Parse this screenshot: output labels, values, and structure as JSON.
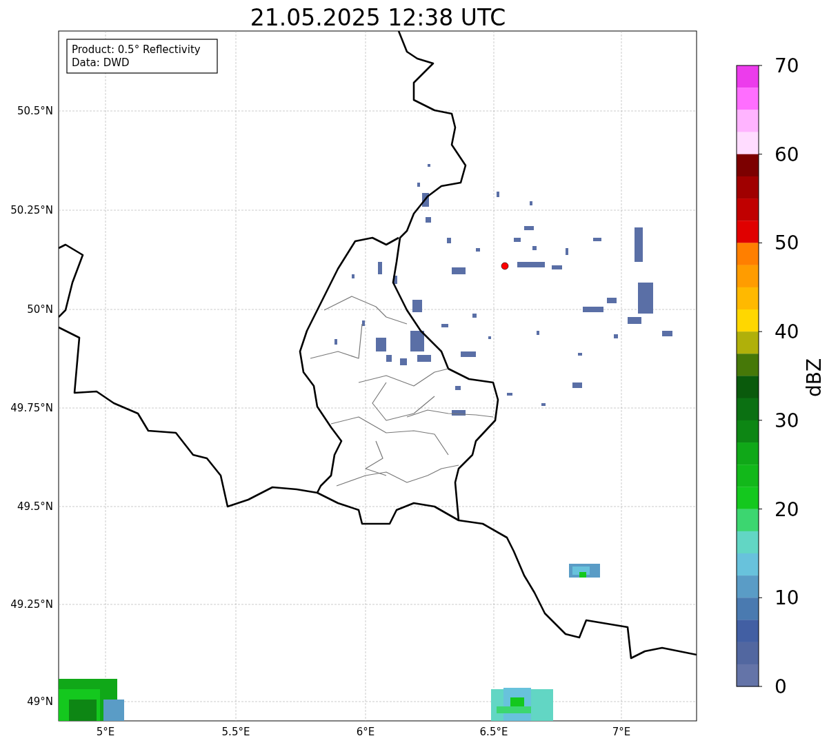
{
  "title": "21.05.2025 12:38 UTC",
  "info_box": [
    "Product: 0.5° Reflectivity",
    "Data: DWD"
  ],
  "map": {
    "yticks": [
      "50.5°N",
      "50.25°N",
      "50°N",
      "49.75°N",
      "49.5°N",
      "49.25°N",
      "49°N"
    ],
    "xticks": [
      "5°E",
      "5.5°E",
      "6°E",
      "6.5°E",
      "7°E"
    ],
    "marker": {
      "color": "#ff0000"
    }
  },
  "colorbar": {
    "label": "dBZ",
    "ticks": [
      "70",
      "60",
      "50",
      "40",
      "30",
      "20",
      "10",
      "0"
    ],
    "segments": [
      {
        "color": "#ec3cec"
      },
      {
        "color": "#ff6eff"
      },
      {
        "color": "#ffb4ff"
      },
      {
        "color": "#ffdcff"
      },
      {
        "color": "#7c0000"
      },
      {
        "color": "#a00000"
      },
      {
        "color": "#c00000"
      },
      {
        "color": "#e00000"
      },
      {
        "color": "#ff7f00"
      },
      {
        "color": "#ff9c00"
      },
      {
        "color": "#ffb900"
      },
      {
        "color": "#ffd700"
      },
      {
        "color": "#b0b00a"
      },
      {
        "color": "#467808"
      },
      {
        "color": "#0a5a0c"
      },
      {
        "color": "#0b7012"
      },
      {
        "color": "#0d8614"
      },
      {
        "color": "#10a818"
      },
      {
        "color": "#12b81a"
      },
      {
        "color": "#14c81e"
      },
      {
        "color": "#3cd670"
      },
      {
        "color": "#62d6c4"
      },
      {
        "color": "#68c2dc"
      },
      {
        "color": "#5a9cc6"
      },
      {
        "color": "#4a7ab0"
      },
      {
        "color": "#425fa3"
      },
      {
        "color": "#5267a0"
      },
      {
        "color": "#6474a8"
      }
    ]
  }
}
